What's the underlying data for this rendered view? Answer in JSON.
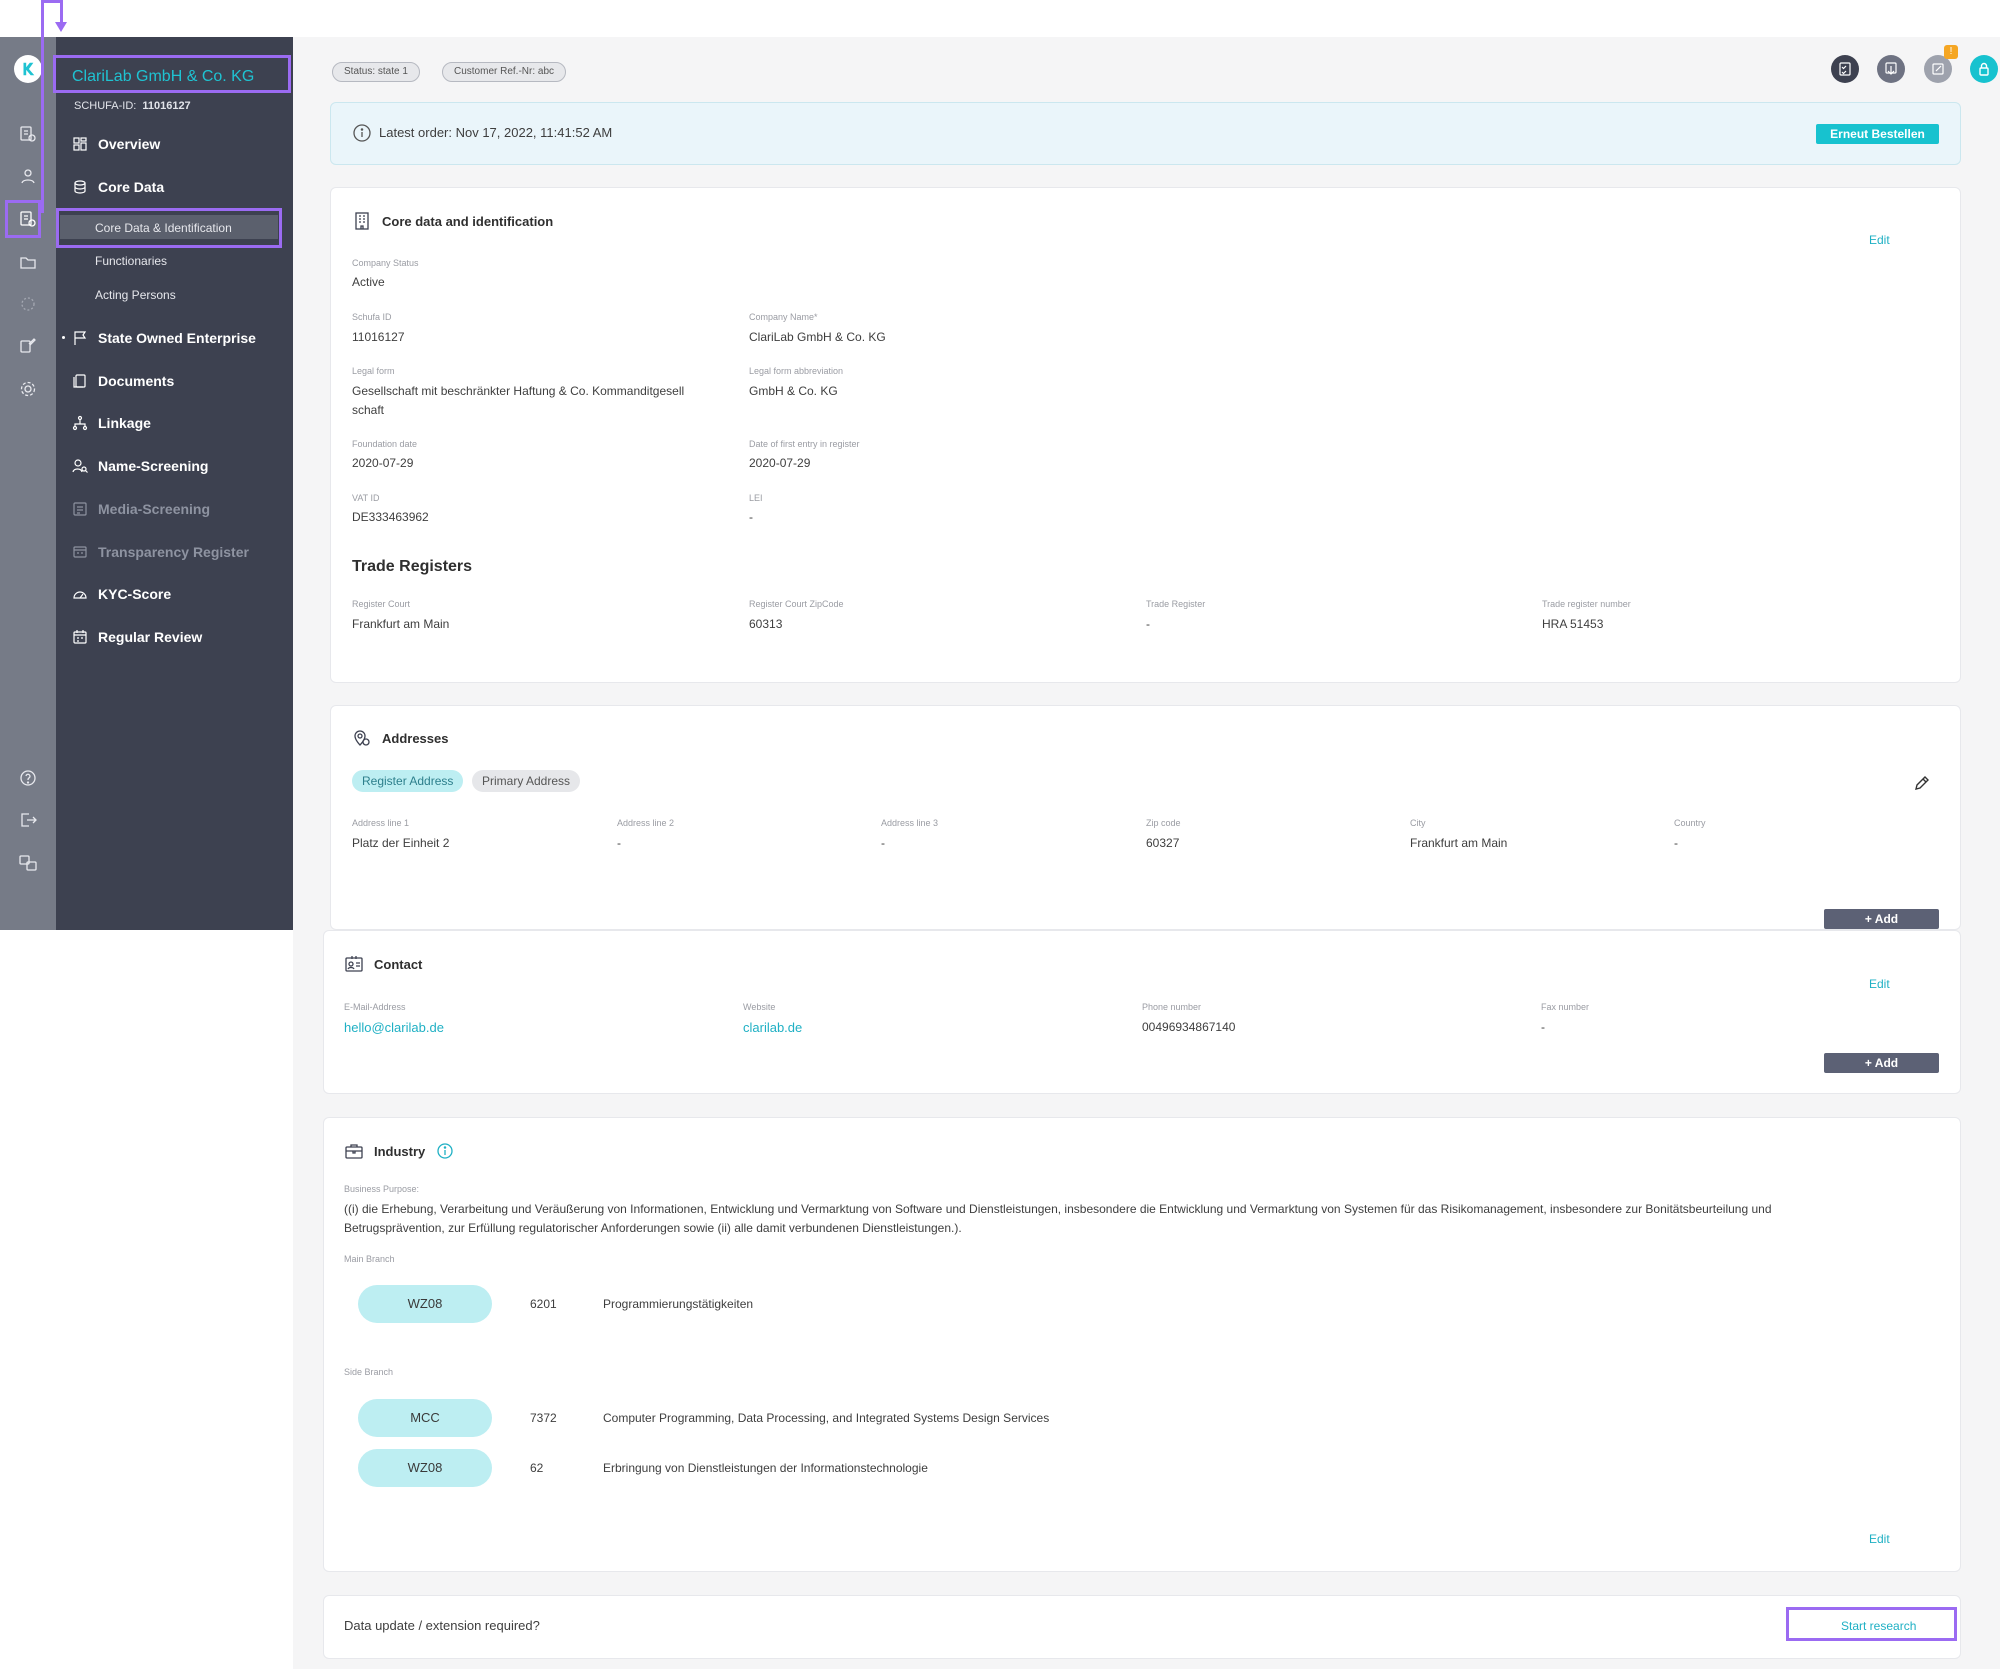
{
  "company": {
    "name": "ClariLab GmbH & Co. KG",
    "schufa_label": "SCHUFA-ID:",
    "schufa_id": "11016127"
  },
  "sidebar": {
    "items": [
      {
        "label": "Overview"
      },
      {
        "label": "Core Data"
      },
      {
        "label": "State Owned Enterprise"
      },
      {
        "label": "Documents"
      },
      {
        "label": "Linkage"
      },
      {
        "label": "Name-Screening"
      },
      {
        "label": "Media-Screening"
      },
      {
        "label": "Transparency Register"
      },
      {
        "label": "KYC-Score"
      },
      {
        "label": "Regular Review"
      }
    ],
    "subitems": [
      {
        "label": "Core Data & Identification"
      },
      {
        "label": "Functionaries"
      },
      {
        "label": "Acting Persons"
      }
    ]
  },
  "header": {
    "status": "Status: state 1",
    "customer_ref": "Customer Ref.-Nr: abc",
    "notification_badge": "!"
  },
  "order_banner": {
    "text": "Latest order: Nov 17, 2022, 11:41:52 AM",
    "button": "Erneut Bestellen"
  },
  "core": {
    "title": "Core data and identification",
    "edit": "Edit",
    "company_status_label": "Company Status",
    "company_status": "Active",
    "schufa_id_label": "Schufa ID",
    "schufa_id": "11016127",
    "company_name_label": "Company Name*",
    "company_name": "ClariLab GmbH & Co. KG",
    "legal_form_label": "Legal form",
    "legal_form_line1": "Gesellschaft mit beschränkter Haftung & Co. Kommanditgesell",
    "legal_form_line2": "schaft",
    "legal_abbr_label": "Legal form abbreviation",
    "legal_abbr": "GmbH & Co. KG",
    "foundation_label": "Foundation date",
    "foundation": "2020-07-29",
    "first_entry_label": "Date of first entry in register",
    "first_entry": "2020-07-29",
    "vat_label": "VAT ID",
    "vat": "DE333463962",
    "lei_label": "LEI",
    "lei": "-",
    "trade_title": "Trade Registers",
    "court_label": "Register Court",
    "court": "Frankfurt am Main",
    "court_zip_label": "Register Court ZipCode",
    "court_zip": "60313",
    "trade_register_label": "Trade Register",
    "trade_register": "-",
    "trade_number_label": "Trade register number",
    "trade_number": "HRA 51453"
  },
  "addresses": {
    "title": "Addresses",
    "tab_register": "Register Address",
    "tab_primary": "Primary Address",
    "columns": [
      {
        "label": "Address line 1",
        "value": "Platz der Einheit 2"
      },
      {
        "label": "Address line 2",
        "value": "-"
      },
      {
        "label": "Address line 3",
        "value": "-"
      },
      {
        "label": "Zip code",
        "value": "60327"
      },
      {
        "label": "City",
        "value": "Frankfurt am Main"
      },
      {
        "label": "Country",
        "value": "-"
      }
    ],
    "add": "+ Add"
  },
  "contact": {
    "title": "Contact",
    "edit": "Edit",
    "email_label": "E-Mail-Address",
    "email": "hello@clarilab.de",
    "website_label": "Website",
    "website": "clarilab.de",
    "phone_label": "Phone number",
    "phone": "00496934867140",
    "fax_label": "Fax number",
    "fax": "-",
    "add": "+ Add"
  },
  "industry": {
    "title": "Industry",
    "purpose_label": "Business Purpose:",
    "purpose_line1": "((i) die Erhebung, Verarbeitung und Veräußerung von Informationen, Entwicklung und Vermarktung von Software und Dienstleistungen, insbesondere die Entwicklung und Vermarktung von Systemen für das Risikomanagement, insbesondere zur Bonitätsbeurteilung und",
    "purpose_line2": "Betrugsprävention, zur Erfüllung regulatorischer Anforderungen sowie (ii) alle damit verbundenen Dienstleistungen.).",
    "main_branch_label": "Main Branch",
    "main_branch": [
      {
        "scheme": "WZ08",
        "code": "6201",
        "desc": "Programmierungstätigkeiten"
      }
    ],
    "side_branch_label": "Side Branch",
    "side_branch": [
      {
        "scheme": "MCC",
        "code": "7372",
        "desc": "Computer Programming, Data Processing, and Integrated Systems Design Services"
      },
      {
        "scheme": "WZ08",
        "code": "62",
        "desc": "Erbringung von Dienstleistungen der Informationstechnologie"
      }
    ],
    "edit": "Edit"
  },
  "research": {
    "text": "Data update / extension required?",
    "button": "Start research"
  },
  "colors": {
    "accent": "#17c2cf",
    "sidebar": "#3d4150",
    "rail": "#767b87",
    "highlight": "#9b6bf2"
  }
}
